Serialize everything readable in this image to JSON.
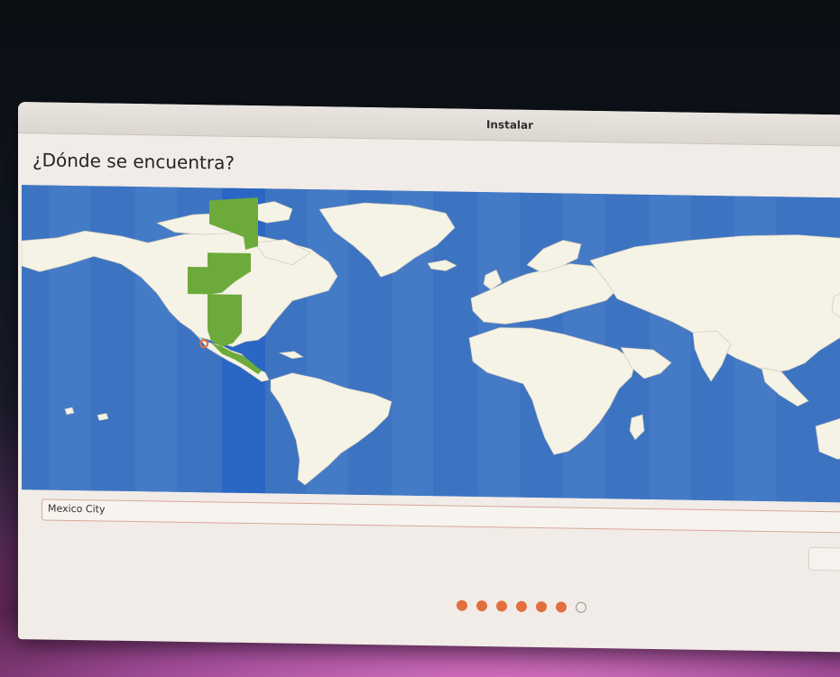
{
  "window": {
    "title": "Instalar"
  },
  "page": {
    "heading": "¿Dónde se encuentra?"
  },
  "map": {
    "selected_city": "Mexico City",
    "ocean_color": "#3d74c2",
    "land_color": "#f5f2e6",
    "highlight_color": "#6cab3b",
    "selected_band_color": "#2a66c4",
    "pin_color": "#e26f3e"
  },
  "location_input": {
    "value": "Mexico City"
  },
  "progress": {
    "total_steps": 7,
    "completed_steps": 6,
    "accent": "#e26f3e"
  }
}
